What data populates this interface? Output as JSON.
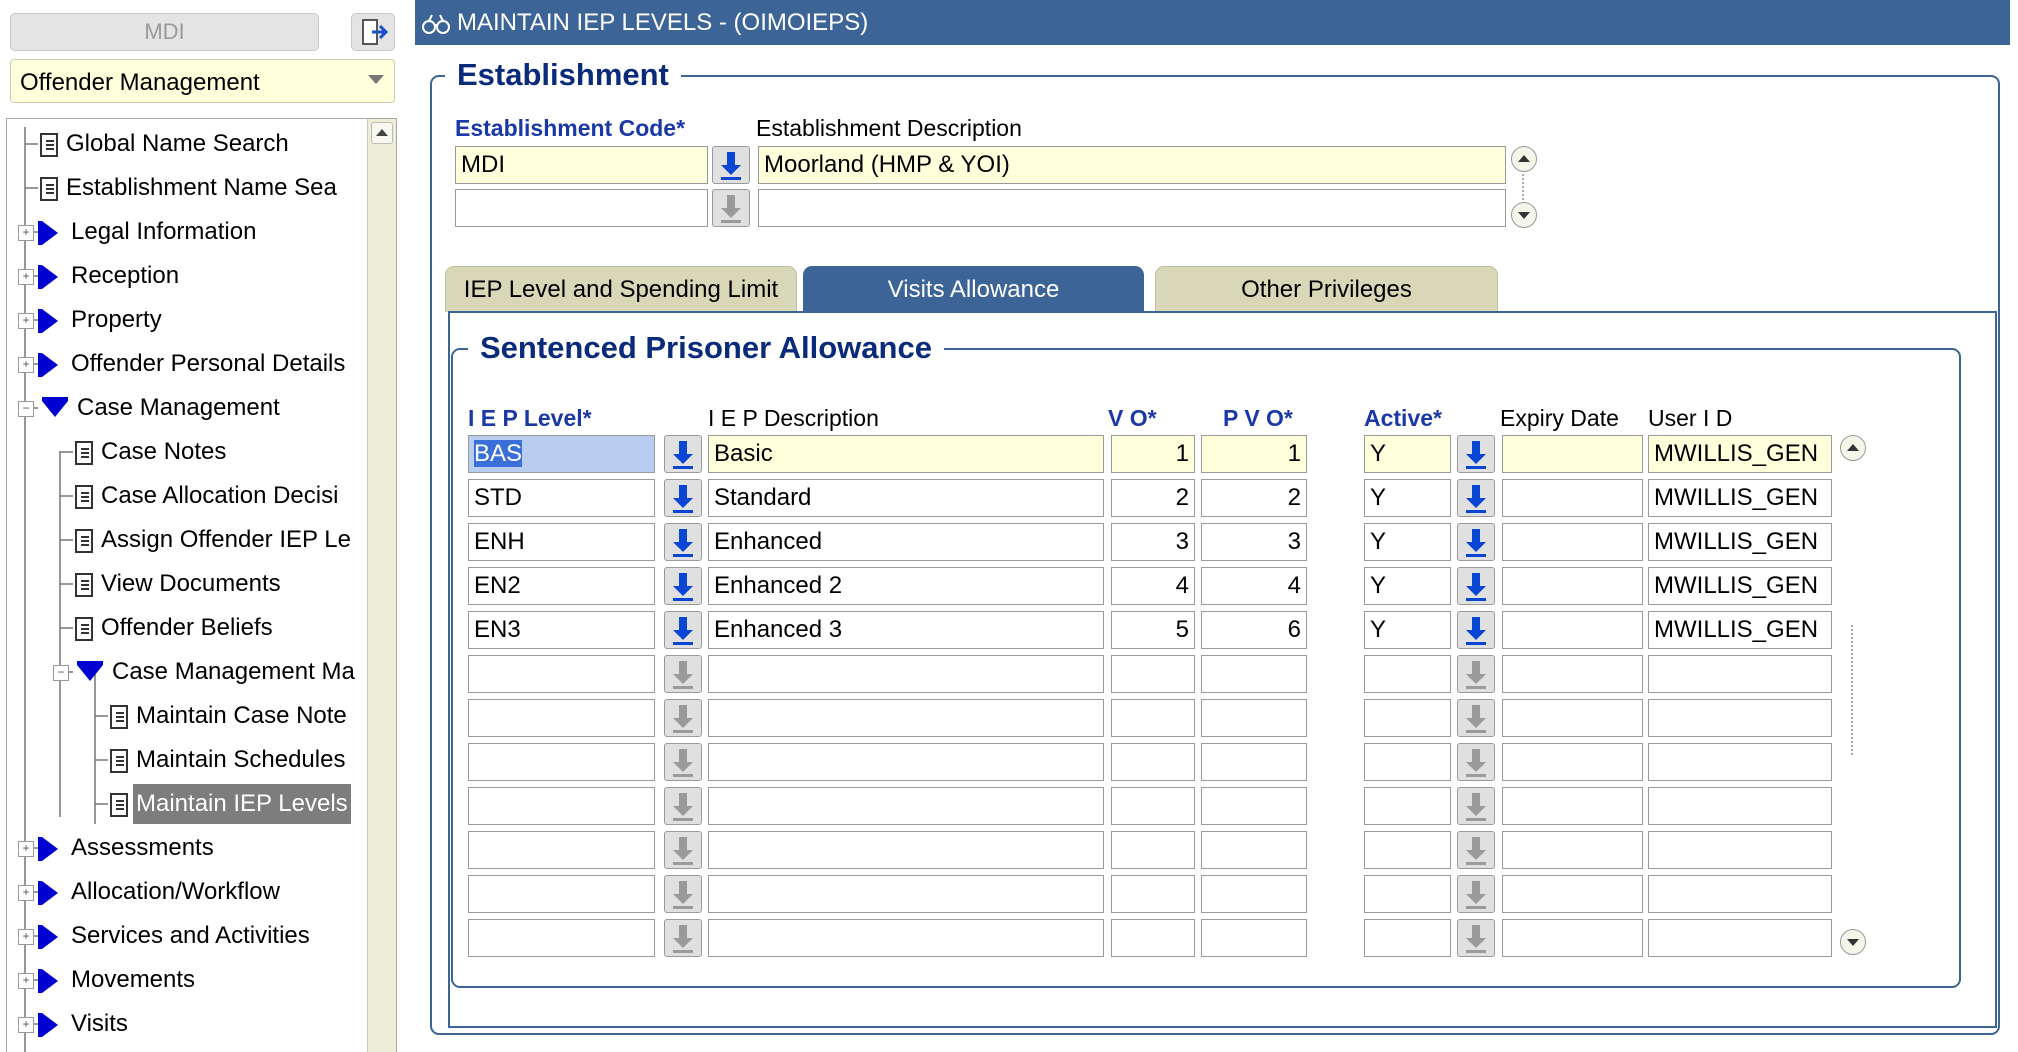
{
  "nav": {
    "caseload": "MDI",
    "module": "Offender Management",
    "tree": [
      {
        "label": "Global Name Search",
        "type": "page",
        "indent": 0
      },
      {
        "label": "Establishment Name Sea",
        "type": "page",
        "indent": 0
      },
      {
        "label": "Legal Information",
        "type": "folder",
        "indent": 0
      },
      {
        "label": "Reception",
        "type": "folder",
        "indent": 0
      },
      {
        "label": "Property",
        "type": "folder",
        "indent": 0
      },
      {
        "label": "Offender Personal Details",
        "type": "folder",
        "indent": 0
      },
      {
        "label": "Case Management",
        "type": "open",
        "indent": 0
      },
      {
        "label": "Case Notes",
        "type": "page",
        "indent": 1
      },
      {
        "label": "Case Allocation Decisi",
        "type": "page",
        "indent": 1
      },
      {
        "label": "Assign Offender IEP Le",
        "type": "page",
        "indent": 1
      },
      {
        "label": "View Documents",
        "type": "page",
        "indent": 1
      },
      {
        "label": "Offender Beliefs",
        "type": "page",
        "indent": 1
      },
      {
        "label": "Case Management Ma",
        "type": "open",
        "indent": 1
      },
      {
        "label": "Maintain Case Note",
        "type": "page",
        "indent": 2
      },
      {
        "label": "Maintain Schedules",
        "type": "page",
        "indent": 2
      },
      {
        "label": "Maintain IEP Levels",
        "type": "page",
        "indent": 2,
        "selected": true
      },
      {
        "label": "Assessments",
        "type": "folder",
        "indent": 0
      },
      {
        "label": "Allocation/Workflow",
        "type": "folder",
        "indent": 0
      },
      {
        "label": "Services and Activities",
        "type": "folder",
        "indent": 0
      },
      {
        "label": "Movements",
        "type": "folder",
        "indent": 0
      },
      {
        "label": "Visits",
        "type": "folder",
        "indent": 0
      }
    ]
  },
  "window": {
    "title": "MAINTAIN IEP LEVELS - (OIMOIEPS)"
  },
  "establishment": {
    "section_title": "Establishment",
    "code_label": "Establishment Code*",
    "desc_label": "Establishment Description",
    "rows": [
      {
        "code": "MDI",
        "desc": "Moorland (HMP & YOI)"
      },
      {
        "code": "",
        "desc": ""
      }
    ]
  },
  "tabs": [
    {
      "label": "IEP Level and Spending Limit",
      "active": false
    },
    {
      "label": "Visits Allowance",
      "active": true
    },
    {
      "label": "Other Privileges",
      "active": false
    }
  ],
  "allowance": {
    "section_title": "Sentenced Prisoner Allowance",
    "columns": {
      "level": "I E P Level*",
      "desc": "I E P Description",
      "vo": "V O*",
      "pvo": "P V O*",
      "active": "Active*",
      "expiry": "Expiry Date",
      "user": "User I D"
    },
    "rows": [
      {
        "level": "BAS",
        "desc": "Basic",
        "vo": "1",
        "pvo": "1",
        "active": "Y",
        "expiry": "",
        "user": "MWILLIS_GEN"
      },
      {
        "level": "STD",
        "desc": "Standard",
        "vo": "2",
        "pvo": "2",
        "active": "Y",
        "expiry": "",
        "user": "MWILLIS_GEN"
      },
      {
        "level": "ENH",
        "desc": "Enhanced",
        "vo": "3",
        "pvo": "3",
        "active": "Y",
        "expiry": "",
        "user": "MWILLIS_GEN"
      },
      {
        "level": "EN2",
        "desc": "Enhanced 2",
        "vo": "4",
        "pvo": "4",
        "active": "Y",
        "expiry": "",
        "user": "MWILLIS_GEN"
      },
      {
        "level": "EN3",
        "desc": "Enhanced 3",
        "vo": "5",
        "pvo": "6",
        "active": "Y",
        "expiry": "",
        "user": "MWILLIS_GEN"
      },
      {
        "level": "",
        "desc": "",
        "vo": "",
        "pvo": "",
        "active": "",
        "expiry": "",
        "user": ""
      },
      {
        "level": "",
        "desc": "",
        "vo": "",
        "pvo": "",
        "active": "",
        "expiry": "",
        "user": ""
      },
      {
        "level": "",
        "desc": "",
        "vo": "",
        "pvo": "",
        "active": "",
        "expiry": "",
        "user": ""
      },
      {
        "level": "",
        "desc": "",
        "vo": "",
        "pvo": "",
        "active": "",
        "expiry": "",
        "user": ""
      },
      {
        "level": "",
        "desc": "",
        "vo": "",
        "pvo": "",
        "active": "",
        "expiry": "",
        "user": ""
      },
      {
        "level": "",
        "desc": "",
        "vo": "",
        "pvo": "",
        "active": "",
        "expiry": "",
        "user": ""
      },
      {
        "level": "",
        "desc": "",
        "vo": "",
        "pvo": "",
        "active": "",
        "expiry": "",
        "user": ""
      }
    ]
  },
  "colors": {
    "title_bar": "#3c6496",
    "label_required": "#1a38a6",
    "field_yellow": "#ffffdc",
    "tab_inactive": "#d8d8b8"
  }
}
